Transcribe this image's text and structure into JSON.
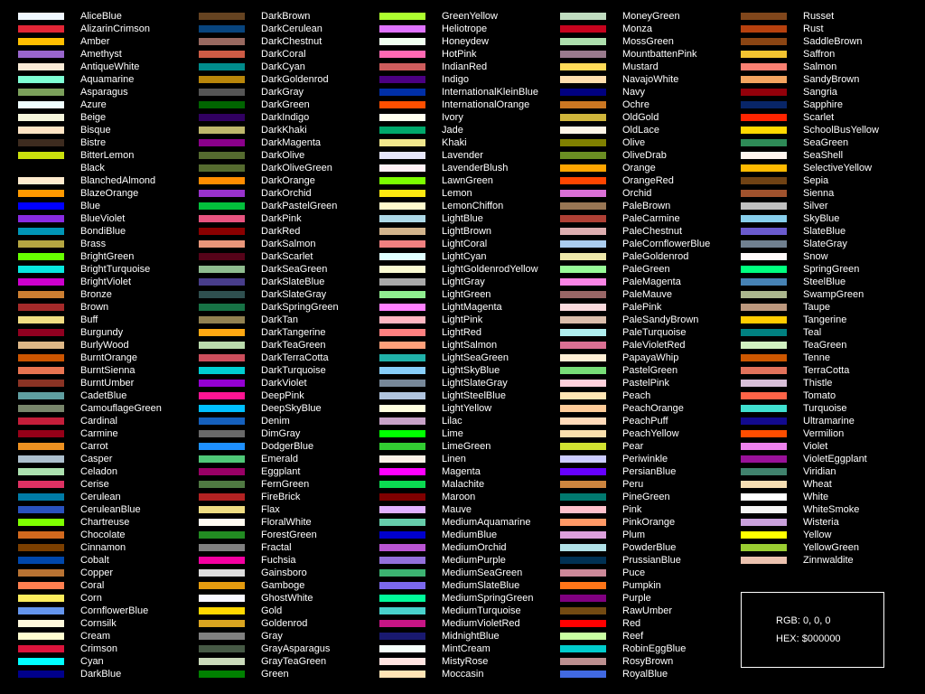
{
  "columns": [
    [
      {
        "name": "AliceBlue",
        "hex": "#F0F8FF"
      },
      {
        "name": "AlizarinCrimson",
        "hex": "#E32636"
      },
      {
        "name": "Amber",
        "hex": "#FFBF00"
      },
      {
        "name": "Amethyst",
        "hex": "#9966CC"
      },
      {
        "name": "AntiqueWhite",
        "hex": "#FAEBD7"
      },
      {
        "name": "Aquamarine",
        "hex": "#7FFFD4"
      },
      {
        "name": "Asparagus",
        "hex": "#7BA05B"
      },
      {
        "name": "Azure",
        "hex": "#F0FFFF"
      },
      {
        "name": "Beige",
        "hex": "#F5F5DC"
      },
      {
        "name": "Bisque",
        "hex": "#FFE4C4"
      },
      {
        "name": "Bistre",
        "hex": "#3D2B1F"
      },
      {
        "name": "BitterLemon",
        "hex": "#CAE00D"
      },
      {
        "name": "Black",
        "hex": "#000000"
      },
      {
        "name": "BlanchedAlmond",
        "hex": "#FFEBCD"
      },
      {
        "name": "BlazeOrange",
        "hex": "#FF9900"
      },
      {
        "name": "Blue",
        "hex": "#0000FF"
      },
      {
        "name": "BlueViolet",
        "hex": "#8A2BE2"
      },
      {
        "name": "BondiBlue",
        "hex": "#0095B6"
      },
      {
        "name": "Brass",
        "hex": "#B5A642"
      },
      {
        "name": "BrightGreen",
        "hex": "#66FF00"
      },
      {
        "name": "BrightTurquoise",
        "hex": "#08E8DE"
      },
      {
        "name": "BrightViolet",
        "hex": "#CD00CD"
      },
      {
        "name": "Bronze",
        "hex": "#CD7F32"
      },
      {
        "name": "Brown",
        "hex": "#A52A2A"
      },
      {
        "name": "Buff",
        "hex": "#F0DC82"
      },
      {
        "name": "Burgundy",
        "hex": "#900020"
      },
      {
        "name": "BurlyWood",
        "hex": "#DEB887"
      },
      {
        "name": "BurntOrange",
        "hex": "#CC5500"
      },
      {
        "name": "BurntSienna",
        "hex": "#E97451"
      },
      {
        "name": "BurntUmber",
        "hex": "#8A3324"
      },
      {
        "name": "CadetBlue",
        "hex": "#5F9EA0"
      },
      {
        "name": "CamouflageGreen",
        "hex": "#78866B"
      },
      {
        "name": "Cardinal",
        "hex": "#C41E3A"
      },
      {
        "name": "Carmine",
        "hex": "#960018"
      },
      {
        "name": "Carrot",
        "hex": "#ED9121"
      },
      {
        "name": "Casper",
        "hex": "#ACBFCD"
      },
      {
        "name": "Celadon",
        "hex": "#ACE1AF"
      },
      {
        "name": "Cerise",
        "hex": "#DE3163"
      },
      {
        "name": "Cerulean",
        "hex": "#007BA7"
      },
      {
        "name": "CeruleanBlue",
        "hex": "#2A52BE"
      },
      {
        "name": "Chartreuse",
        "hex": "#7FFF00"
      },
      {
        "name": "Chocolate",
        "hex": "#D2691E"
      },
      {
        "name": "Cinnamon",
        "hex": "#7B3F00"
      },
      {
        "name": "Cobalt",
        "hex": "#0047AB"
      },
      {
        "name": "Copper",
        "hex": "#B87333"
      },
      {
        "name": "Coral",
        "hex": "#FF7F50"
      },
      {
        "name": "Corn",
        "hex": "#FBEC5D"
      },
      {
        "name": "CornflowerBlue",
        "hex": "#6495ED"
      },
      {
        "name": "Cornsilk",
        "hex": "#FFF8DC"
      },
      {
        "name": "Cream",
        "hex": "#FFFDD0"
      },
      {
        "name": "Crimson",
        "hex": "#DC143C"
      },
      {
        "name": "Cyan",
        "hex": "#00FFFF"
      },
      {
        "name": "DarkBlue",
        "hex": "#00008B"
      }
    ],
    [
      {
        "name": "DarkBrown",
        "hex": "#654321"
      },
      {
        "name": "DarkCerulean",
        "hex": "#08457E"
      },
      {
        "name": "DarkChestnut",
        "hex": "#986960"
      },
      {
        "name": "DarkCoral",
        "hex": "#CD5B45"
      },
      {
        "name": "DarkCyan",
        "hex": "#008B8B"
      },
      {
        "name": "DarkGoldenrod",
        "hex": "#B8860B"
      },
      {
        "name": "DarkGray",
        "hex": "#555555"
      },
      {
        "name": "DarkGreen",
        "hex": "#006400"
      },
      {
        "name": "DarkIndigo",
        "hex": "#310062"
      },
      {
        "name": "DarkKhaki",
        "hex": "#BDB76B"
      },
      {
        "name": "DarkMagenta",
        "hex": "#8B008B"
      },
      {
        "name": "DarkOlive",
        "hex": "#556B2F"
      },
      {
        "name": "DarkOliveGreen",
        "hex": "#556B2F"
      },
      {
        "name": "DarkOrange",
        "hex": "#FF8C00"
      },
      {
        "name": "DarkOrchid",
        "hex": "#9932CC"
      },
      {
        "name": "DarkPastelGreen",
        "hex": "#03C03C"
      },
      {
        "name": "DarkPink",
        "hex": "#E75480"
      },
      {
        "name": "DarkRed",
        "hex": "#8B0000"
      },
      {
        "name": "DarkSalmon",
        "hex": "#E9967A"
      },
      {
        "name": "DarkScarlet",
        "hex": "#560319"
      },
      {
        "name": "DarkSeaGreen",
        "hex": "#8FBC8F"
      },
      {
        "name": "DarkSlateBlue",
        "hex": "#483D8B"
      },
      {
        "name": "DarkSlateGray",
        "hex": "#2F4F4F"
      },
      {
        "name": "DarkSpringGreen",
        "hex": "#177245"
      },
      {
        "name": "DarkTan",
        "hex": "#918151"
      },
      {
        "name": "DarkTangerine",
        "hex": "#FFA812"
      },
      {
        "name": "DarkTeaGreen",
        "hex": "#BADBAD"
      },
      {
        "name": "DarkTerraCotta",
        "hex": "#CC4E5C"
      },
      {
        "name": "DarkTurquoise",
        "hex": "#00CED1"
      },
      {
        "name": "DarkViolet",
        "hex": "#9400D3"
      },
      {
        "name": "DeepPink",
        "hex": "#FF1493"
      },
      {
        "name": "DeepSkyBlue",
        "hex": "#00BFFF"
      },
      {
        "name": "Denim",
        "hex": "#1560BD"
      },
      {
        "name": "DimGray",
        "hex": "#696969"
      },
      {
        "name": "DodgerBlue",
        "hex": "#1E90FF"
      },
      {
        "name": "Emerald",
        "hex": "#50C878"
      },
      {
        "name": "Eggplant",
        "hex": "#990066"
      },
      {
        "name": "FernGreen",
        "hex": "#4F7942"
      },
      {
        "name": "FireBrick",
        "hex": "#B22222"
      },
      {
        "name": "Flax",
        "hex": "#EEDC82"
      },
      {
        "name": "FloralWhite",
        "hex": "#FFFAF0"
      },
      {
        "name": "ForestGreen",
        "hex": "#228B22"
      },
      {
        "name": "Fractal",
        "hex": "#808080"
      },
      {
        "name": "Fuchsia",
        "hex": "#F400A1"
      },
      {
        "name": "Gainsboro",
        "hex": "#DCDCDC"
      },
      {
        "name": "Gamboge",
        "hex": "#E49B0F"
      },
      {
        "name": "GhostWhite",
        "hex": "#F8F8FF"
      },
      {
        "name": "Gold",
        "hex": "#FFD700"
      },
      {
        "name": "Goldenrod",
        "hex": "#DAA520"
      },
      {
        "name": "Gray",
        "hex": "#808080"
      },
      {
        "name": "GrayAsparagus",
        "hex": "#465945"
      },
      {
        "name": "GrayTeaGreen",
        "hex": "#CADABA"
      },
      {
        "name": "Green",
        "hex": "#008000"
      }
    ],
    [
      {
        "name": "GreenYellow",
        "hex": "#ADFF2F"
      },
      {
        "name": "Heliotrope",
        "hex": "#DF73FF"
      },
      {
        "name": "Honeydew",
        "hex": "#F0FFF0"
      },
      {
        "name": "HotPink",
        "hex": "#FF69B4"
      },
      {
        "name": "IndianRed",
        "hex": "#CD5C5C"
      },
      {
        "name": "Indigo",
        "hex": "#4B0082"
      },
      {
        "name": "InternationalKleinBlue",
        "hex": "#002FA7"
      },
      {
        "name": "InternationalOrange",
        "hex": "#FF4F00"
      },
      {
        "name": "Ivory",
        "hex": "#FFFFF0"
      },
      {
        "name": "Jade",
        "hex": "#00A86B"
      },
      {
        "name": "Khaki",
        "hex": "#F0E68C"
      },
      {
        "name": "Lavender",
        "hex": "#E6E6FA"
      },
      {
        "name": "LavenderBlush",
        "hex": "#FFF0F5"
      },
      {
        "name": "LawnGreen",
        "hex": "#7CFC00"
      },
      {
        "name": "Lemon",
        "hex": "#FDE910"
      },
      {
        "name": "LemonChiffon",
        "hex": "#FFFACD"
      },
      {
        "name": "LightBlue",
        "hex": "#ADD8E6"
      },
      {
        "name": "LightBrown",
        "hex": "#D2B48C"
      },
      {
        "name": "LightCoral",
        "hex": "#F08080"
      },
      {
        "name": "LightCyan",
        "hex": "#E0FFFF"
      },
      {
        "name": "LightGoldenrodYellow",
        "hex": "#FAFAD2"
      },
      {
        "name": "LightGray",
        "hex": "#A9A9A9"
      },
      {
        "name": "LightGreen",
        "hex": "#90EE90"
      },
      {
        "name": "LightMagenta",
        "hex": "#FF80FF"
      },
      {
        "name": "LightPink",
        "hex": "#FFB6C1"
      },
      {
        "name": "LightRed",
        "hex": "#FF8080"
      },
      {
        "name": "LightSalmon",
        "hex": "#FFA07A"
      },
      {
        "name": "LightSeaGreen",
        "hex": "#20B2AA"
      },
      {
        "name": "LightSkyBlue",
        "hex": "#87CEFA"
      },
      {
        "name": "LightSlateGray",
        "hex": "#778899"
      },
      {
        "name": "LightSteelBlue",
        "hex": "#B0C4DE"
      },
      {
        "name": "LightYellow",
        "hex": "#FFFFE0"
      },
      {
        "name": "Lilac",
        "hex": "#C8A2C8"
      },
      {
        "name": "Lime",
        "hex": "#00FF00"
      },
      {
        "name": "LimeGreen",
        "hex": "#32CD32"
      },
      {
        "name": "Linen",
        "hex": "#FAF0E6"
      },
      {
        "name": "Magenta",
        "hex": "#FF00FF"
      },
      {
        "name": "Malachite",
        "hex": "#0BDA51"
      },
      {
        "name": "Maroon",
        "hex": "#800000"
      },
      {
        "name": "Mauve",
        "hex": "#E0B0FF"
      },
      {
        "name": "MediumAquamarine",
        "hex": "#66CDAA"
      },
      {
        "name": "MediumBlue",
        "hex": "#0000CD"
      },
      {
        "name": "MediumOrchid",
        "hex": "#BA55D3"
      },
      {
        "name": "MediumPurple",
        "hex": "#9370DB"
      },
      {
        "name": "MediumSeaGreen",
        "hex": "#3CB371"
      },
      {
        "name": "MediumSlateBlue",
        "hex": "#7B68EE"
      },
      {
        "name": "MediumSpringGreen",
        "hex": "#00FA9A"
      },
      {
        "name": "MediumTurquoise",
        "hex": "#48D1CC"
      },
      {
        "name": "MediumVioletRed",
        "hex": "#C71585"
      },
      {
        "name": "MidnightBlue",
        "hex": "#191970"
      },
      {
        "name": "MintCream",
        "hex": "#F5FFFA"
      },
      {
        "name": "MistyRose",
        "hex": "#FFE4E1"
      },
      {
        "name": "Moccasin",
        "hex": "#FFE4B5"
      }
    ],
    [
      {
        "name": "MoneyGreen",
        "hex": "#C0DCC0"
      },
      {
        "name": "Monza",
        "hex": "#C7031E"
      },
      {
        "name": "MossGreen",
        "hex": "#ADDFAD"
      },
      {
        "name": "MountbattenPink",
        "hex": "#997A8D"
      },
      {
        "name": "Mustard",
        "hex": "#FFDB58"
      },
      {
        "name": "NavajoWhite",
        "hex": "#FFDEAD"
      },
      {
        "name": "Navy",
        "hex": "#000080"
      },
      {
        "name": "Ochre",
        "hex": "#CC7722"
      },
      {
        "name": "OldGold",
        "hex": "#CFB53B"
      },
      {
        "name": "OldLace",
        "hex": "#FDF5E6"
      },
      {
        "name": "Olive",
        "hex": "#808000"
      },
      {
        "name": "OliveDrab",
        "hex": "#6B8E23"
      },
      {
        "name": "Orange",
        "hex": "#FFA500"
      },
      {
        "name": "OrangeRed",
        "hex": "#FF4500"
      },
      {
        "name": "Orchid",
        "hex": "#DA70D6"
      },
      {
        "name": "PaleBrown",
        "hex": "#987654"
      },
      {
        "name": "PaleCarmine",
        "hex": "#AF4035"
      },
      {
        "name": "PaleChestnut",
        "hex": "#DDADAF"
      },
      {
        "name": "PaleCornflowerBlue",
        "hex": "#ABCDEF"
      },
      {
        "name": "PaleGoldenrod",
        "hex": "#EEE8AA"
      },
      {
        "name": "PaleGreen",
        "hex": "#98FB98"
      },
      {
        "name": "PaleMagenta",
        "hex": "#F984E5"
      },
      {
        "name": "PaleMauve",
        "hex": "#996666"
      },
      {
        "name": "PalePink",
        "hex": "#FADADD"
      },
      {
        "name": "PaleSandyBrown",
        "hex": "#DABDAB"
      },
      {
        "name": "PaleTurquoise",
        "hex": "#AFEEEE"
      },
      {
        "name": "PaleVioletRed",
        "hex": "#DB7093"
      },
      {
        "name": "PapayaWhip",
        "hex": "#FFEFD5"
      },
      {
        "name": "PastelGreen",
        "hex": "#77DD77"
      },
      {
        "name": "PastelPink",
        "hex": "#FFD1DC"
      },
      {
        "name": "Peach",
        "hex": "#FFE5B4"
      },
      {
        "name": "PeachOrange",
        "hex": "#FFCC99"
      },
      {
        "name": "PeachPuff",
        "hex": "#FFDAB9"
      },
      {
        "name": "PeachYellow",
        "hex": "#FADFAD"
      },
      {
        "name": "Pear",
        "hex": "#D1E231"
      },
      {
        "name": "Periwinkle",
        "hex": "#CCCCFF"
      },
      {
        "name": "PersianBlue",
        "hex": "#6600FF"
      },
      {
        "name": "Peru",
        "hex": "#CD853F"
      },
      {
        "name": "PineGreen",
        "hex": "#01796F"
      },
      {
        "name": "Pink",
        "hex": "#FFC0CB"
      },
      {
        "name": "PinkOrange",
        "hex": "#FF9966"
      },
      {
        "name": "Plum",
        "hex": "#DDA0DD"
      },
      {
        "name": "PowderBlue",
        "hex": "#B0E0E6"
      },
      {
        "name": "PrussianBlue",
        "hex": "#003153"
      },
      {
        "name": "Puce",
        "hex": "#CC8899"
      },
      {
        "name": "Pumpkin",
        "hex": "#FF7518"
      },
      {
        "name": "Purple",
        "hex": "#800080"
      },
      {
        "name": "RawUmber",
        "hex": "#734A12"
      },
      {
        "name": "Red",
        "hex": "#FF0000"
      },
      {
        "name": "Reef",
        "hex": "#C9FFA2"
      },
      {
        "name": "RobinEggBlue",
        "hex": "#00CCCC"
      },
      {
        "name": "RosyBrown",
        "hex": "#BC8F8F"
      },
      {
        "name": "RoyalBlue",
        "hex": "#4169E1"
      }
    ],
    [
      {
        "name": "Russet",
        "hex": "#80461B"
      },
      {
        "name": "Rust",
        "hex": "#B7410E"
      },
      {
        "name": "SaddleBrown",
        "hex": "#8B4513"
      },
      {
        "name": "Saffron",
        "hex": "#F4C430"
      },
      {
        "name": "Salmon",
        "hex": "#FA8072"
      },
      {
        "name": "SandyBrown",
        "hex": "#F4A460"
      },
      {
        "name": "Sangria",
        "hex": "#92000A"
      },
      {
        "name": "Sapphire",
        "hex": "#082567"
      },
      {
        "name": "Scarlet",
        "hex": "#FF2400"
      },
      {
        "name": "SchoolBusYellow",
        "hex": "#FFD800"
      },
      {
        "name": "SeaGreen",
        "hex": "#2E8B57"
      },
      {
        "name": "SeaShell",
        "hex": "#FFF5EE"
      },
      {
        "name": "SelectiveYellow",
        "hex": "#FFBA00"
      },
      {
        "name": "Sepia",
        "hex": "#704214"
      },
      {
        "name": "Sienna",
        "hex": "#A0522D"
      },
      {
        "name": "Silver",
        "hex": "#C0C0C0"
      },
      {
        "name": "SkyBlue",
        "hex": "#87CEEB"
      },
      {
        "name": "SlateBlue",
        "hex": "#6A5ACD"
      },
      {
        "name": "SlateGray",
        "hex": "#708090"
      },
      {
        "name": "Snow",
        "hex": "#FFFAFA"
      },
      {
        "name": "SpringGreen",
        "hex": "#00FF7F"
      },
      {
        "name": "SteelBlue",
        "hex": "#4682B4"
      },
      {
        "name": "SwampGreen",
        "hex": "#ACB78E"
      },
      {
        "name": "Taupe",
        "hex": "#BC987E"
      },
      {
        "name": "Tangerine",
        "hex": "#FFCC00"
      },
      {
        "name": "Teal",
        "hex": "#008080"
      },
      {
        "name": "TeaGreen",
        "hex": "#D0F0C0"
      },
      {
        "name": "Tenne",
        "hex": "#CD5700"
      },
      {
        "name": "TerraCotta",
        "hex": "#E2725B"
      },
      {
        "name": "Thistle",
        "hex": "#D8BFD8"
      },
      {
        "name": "Tomato",
        "hex": "#FF6347"
      },
      {
        "name": "Turquoise",
        "hex": "#40E0D0"
      },
      {
        "name": "Ultramarine",
        "hex": "#120A8F"
      },
      {
        "name": "Vermilion",
        "hex": "#FF4D00"
      },
      {
        "name": "Violet",
        "hex": "#EE82EE"
      },
      {
        "name": "VioletEggplant",
        "hex": "#991199"
      },
      {
        "name": "Viridian",
        "hex": "#40826D"
      },
      {
        "name": "Wheat",
        "hex": "#F5DEB3"
      },
      {
        "name": "White",
        "hex": "#FFFFFF"
      },
      {
        "name": "WhiteSmoke",
        "hex": "#F5F5F5"
      },
      {
        "name": "Wisteria",
        "hex": "#C9A0DC"
      },
      {
        "name": "Yellow",
        "hex": "#FFFF00"
      },
      {
        "name": "YellowGreen",
        "hex": "#9ACD32"
      },
      {
        "name": "Zinnwaldite",
        "hex": "#EBC2AF"
      }
    ]
  ],
  "info": {
    "rgb_label": "RGB: 0, 0, 0",
    "hex_label": "HEX: $000000"
  }
}
